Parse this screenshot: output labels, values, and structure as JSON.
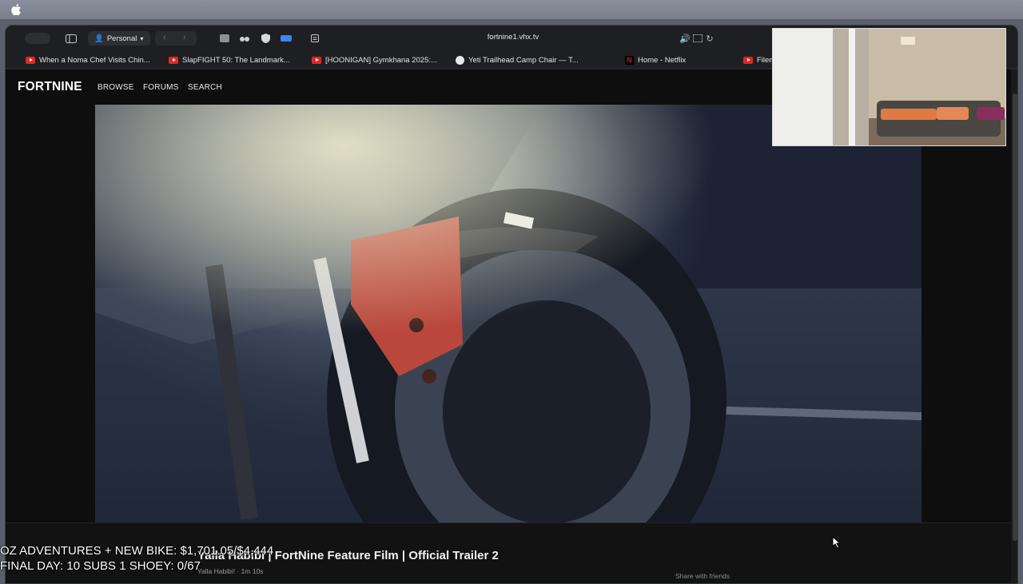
{
  "menubar": {
    "apple_icon": "apple-logo-icon"
  },
  "browser": {
    "profile_label": "Personal",
    "url": "fortnine1.vhx.tv",
    "bookmarks": [
      {
        "label": "When a Noma Chef Visits Chin...",
        "icon": "youtube-icon"
      },
      {
        "label": "SlapFIGHT 50: The Landmark...",
        "icon": "youtube-icon"
      },
      {
        "label": "[HOONIGAN] Gymkhana 2025:...",
        "icon": "youtube-icon"
      },
      {
        "label": "Yeti Trailhead Camp Chair — T...",
        "icon": "yeti-icon"
      },
      {
        "label": "Home - Netflix",
        "icon": "netflix-icon"
      },
      {
        "label": "Filem",
        "icon": "youtube-icon"
      }
    ]
  },
  "site": {
    "logo": "FORTNINE",
    "nav": [
      "BROWSE",
      "FORUMS",
      "SEARCH"
    ]
  },
  "video": {
    "title": "Yalla Habibi | FortNine Feature Film | Official Trailer 2",
    "channel": "Yalla Habibi!",
    "duration": "1m 10s",
    "share_label": "Share with friends"
  },
  "overlay": {
    "line1": "OZ ADVENTURES + NEW BIKE: $1,701.05/$4,444",
    "line2": "FINAL DAY: 10 SUBS 1 SHOEY: 0/67"
  },
  "colors": {
    "page_bg": "#0e0e0f",
    "youtube_red": "#e52620",
    "netflix_red": "#e50914"
  }
}
